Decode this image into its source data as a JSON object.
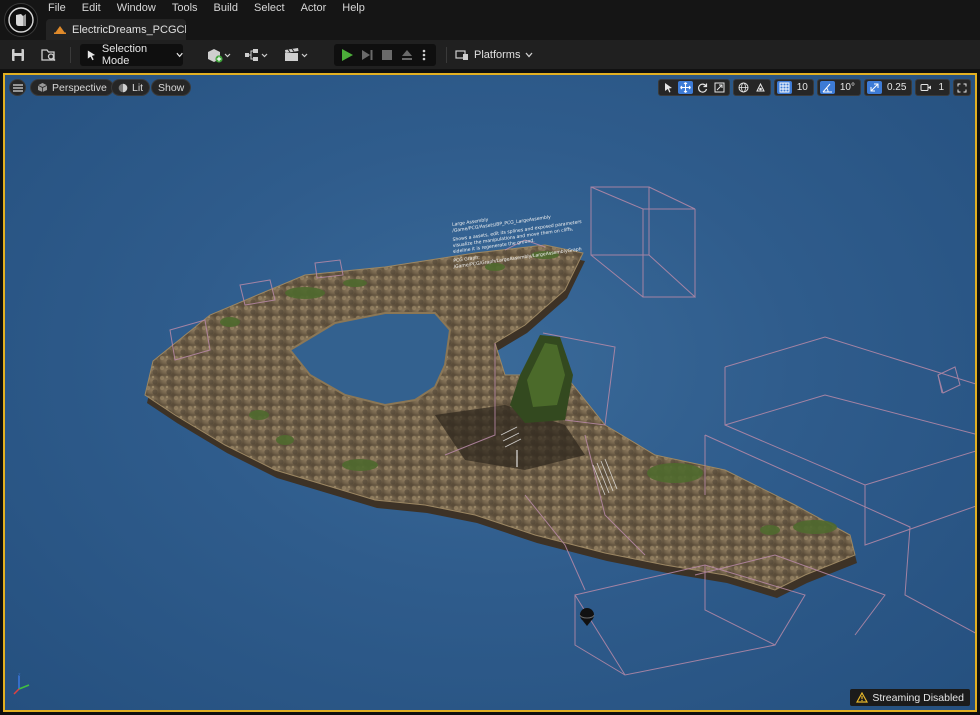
{
  "app": {
    "menus": [
      "File",
      "Edit",
      "Window",
      "Tools",
      "Build",
      "Select",
      "Actor",
      "Help"
    ],
    "document_tab": "ElectricDreams_PCGClo..."
  },
  "toolbar": {
    "save_icon": "save-icon",
    "browse_icon": "content-browse-icon",
    "mode_label": "Selection Mode",
    "add_icon": "add-actor-icon",
    "blueprint_icon": "blueprint-icon",
    "cinematics_icon": "clapperboard-icon",
    "play_icon": "play-icon",
    "platforms_label": "Platforms"
  },
  "viewport": {
    "perspective_label": "Perspective",
    "lit_label": "Lit",
    "show_label": "Show",
    "grid_snap": "10",
    "rotate_snap": "10°",
    "scale_snap": "0.25",
    "camera_speed": "1",
    "streaming_label": "Streaming Disabled",
    "note": {
      "title": "Large Assembly",
      "path": "/Game/PCG/Assets/BP_PCG_LargeAssembly",
      "lines": [
        "Shows a assets, edit its splines and exposed parameters",
        "visualize the manipulations and move them on cliffs,",
        "sideline it is regenerate the ground."
      ],
      "graph_label": "PCG Graph:",
      "graph_path": "/Game/PCG/Graph/LargeAssembly/LargeAssemblyGraph"
    }
  },
  "colors": {
    "selection_border": "#e2b022",
    "sky": "#2f5c8c",
    "active_button": "#3d7bd6",
    "play_green": "#4caf3a",
    "volume_lines": "#b98aa8"
  }
}
